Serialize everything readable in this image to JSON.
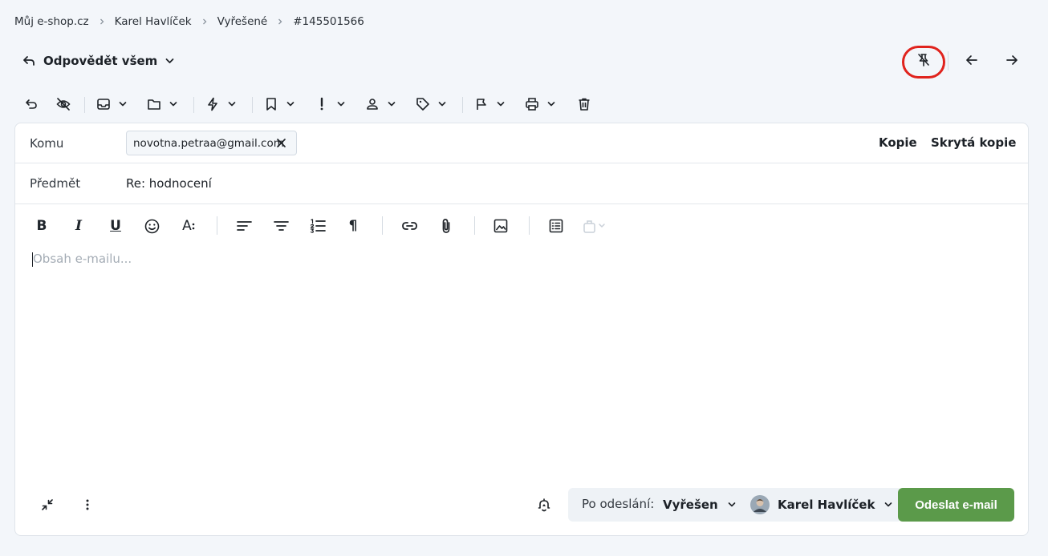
{
  "breadcrumb": {
    "items": [
      "Můj e-shop.cz",
      "Karel Havlíček",
      "Vyřešené",
      "#145501566"
    ]
  },
  "reply": {
    "label": "Odpovědět všem"
  },
  "header_actions": {
    "icons": [
      "unpin-icon",
      "arrow-left-icon",
      "arrow-right-icon"
    ],
    "highlight_color": "#e0231d"
  },
  "toolbar": {
    "icons": [
      "undo-icon",
      "eye-off-icon",
      "inbox-icon",
      "folder-icon",
      "bolt-icon",
      "bookmark-icon",
      "priority-icon",
      "user-icon",
      "tag-icon",
      "flag-icon",
      "print-icon",
      "trash-icon"
    ]
  },
  "compose": {
    "to_label": "Komu",
    "recipient": "novotna.petraa@gmail.com",
    "cc_label": "Kopie",
    "bcc_label": "Skrytá kopie",
    "subject_label": "Předmět",
    "subject_value": "Re: hodnocení",
    "body_placeholder": "Obsah e-mailu..."
  },
  "editor_toolbar": {
    "bold": "B",
    "italic": "I",
    "underline": "U",
    "font_size": "A",
    "paragraph": "¶",
    "icons": [
      "bold-icon",
      "italic-icon",
      "underline-icon",
      "emoji-icon",
      "font-size-icon",
      "align-left-icon",
      "align-center-icon",
      "numbered-list-icon",
      "paragraph-icon",
      "link-icon",
      "attachment-icon",
      "image-icon",
      "template-icon",
      "canned-response-icon"
    ]
  },
  "footer": {
    "after_send_label": "Po odeslání:",
    "after_send_value": "Vyřešen",
    "assignee": "Karel Havlíček",
    "send_label": "Odeslat e-mail",
    "send_color": "#5b9a4a"
  }
}
